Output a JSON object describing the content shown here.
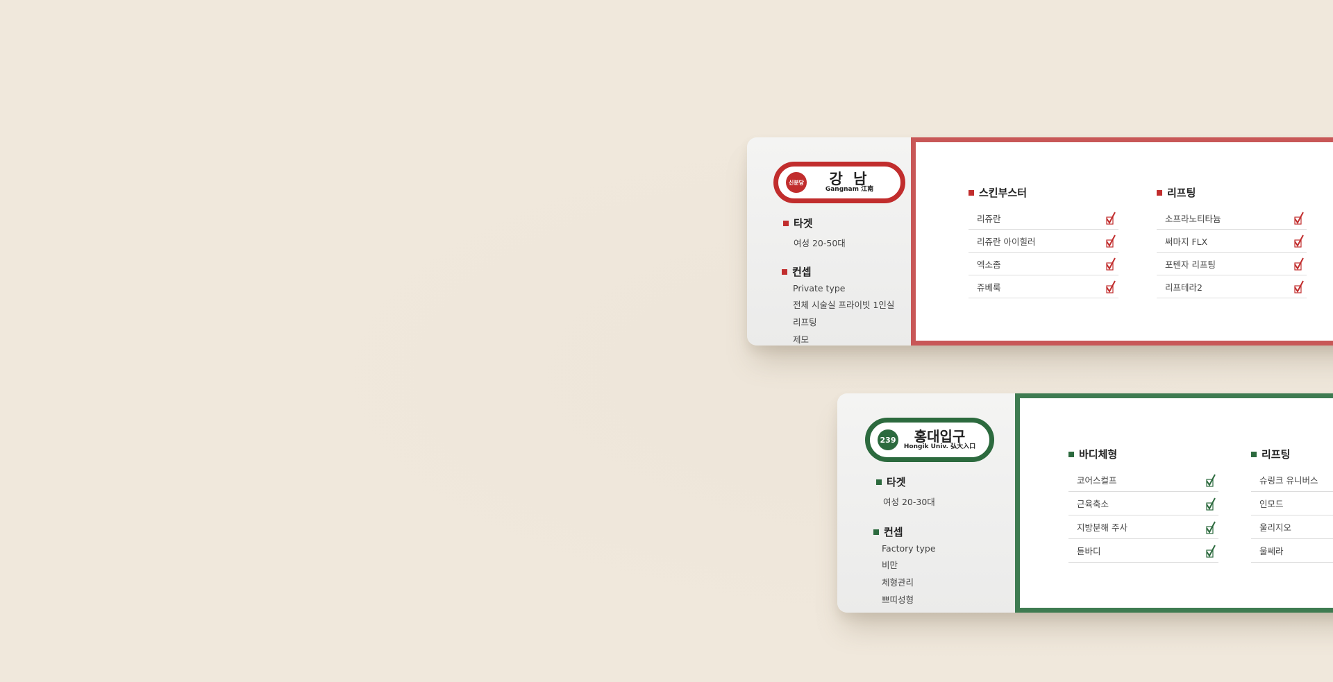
{
  "colors": {
    "background": "#f0e8dc",
    "red_line": "#c12d2d",
    "green_line": "#2c6a3e"
  },
  "cards": [
    {
      "station": {
        "badge": "신분당",
        "name": "강 남",
        "sub": "Gangnam 江南"
      },
      "target": {
        "title": "타겟",
        "value": "여성 20-50대"
      },
      "concept": {
        "title": "컨셉",
        "items": [
          "Private type",
          "전체 시술실 프라이빗 1인실",
          "리프팅",
          "제모"
        ]
      },
      "columns": [
        {
          "title": "스킨부스터",
          "items": [
            "리쥬란",
            "리쥬란 아이힐러",
            "엑소좀",
            "쥬베룩"
          ],
          "checked": true
        },
        {
          "title": "리프팅",
          "items": [
            "소프라노티타늄",
            "써마지 FLX",
            "포텐자 리프팅",
            "리프테라2"
          ],
          "checked": true
        }
      ]
    },
    {
      "station": {
        "badge": "239",
        "name": "홍대입구",
        "sub": "Hongik Univ. 弘大入口"
      },
      "target": {
        "title": "타겟",
        "value": "여성 20-30대"
      },
      "concept": {
        "title": "컨셉",
        "items": [
          "Factory type",
          "비만",
          "체형관리",
          "쁘띠성형"
        ]
      },
      "columns": [
        {
          "title": "바디체형",
          "items": [
            "코어스컬프",
            "근육축소",
            "지방분해 주사",
            "튠바디"
          ],
          "checked": true
        },
        {
          "title": "리프팅",
          "items": [
            "슈링크 유니버스",
            "인모드",
            "울리지오",
            "울쎄라"
          ],
          "checked": false
        }
      ]
    }
  ]
}
